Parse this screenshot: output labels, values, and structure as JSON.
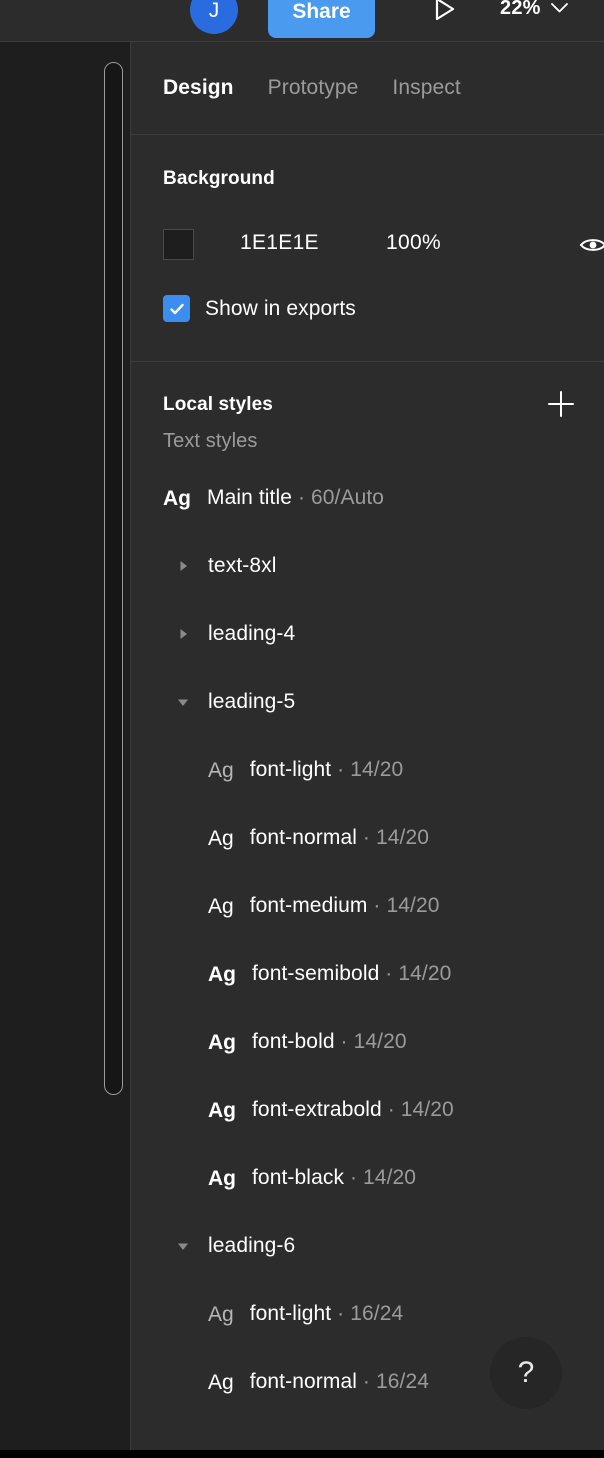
{
  "toolbar": {
    "avatar_initial": "J",
    "share_label": "Share",
    "present_icon": "play-triangle-icon",
    "zoom_level": "22%",
    "zoom_caret_icon": "chevron-down-icon"
  },
  "panel": {
    "tabs": [
      {
        "label": "Design",
        "active": true
      },
      {
        "label": "Prototype",
        "active": false
      },
      {
        "label": "Inspect",
        "active": false
      }
    ],
    "background": {
      "title": "Background",
      "color_hex": "1E1E1E",
      "swatch_color": "#1E1E1E",
      "opacity": "100%",
      "visibility_icon": "eye-icon",
      "show_in_exports": {
        "label": "Show in exports",
        "checked": true,
        "accent": "#3B8EF0"
      }
    },
    "local_styles": {
      "title": "Local styles",
      "add_icon": "plus-icon",
      "text_styles_label": "Text styles",
      "rows": [
        {
          "kind": "style",
          "level": 0,
          "preview": "Ag",
          "weight": "w700",
          "name": "Main title",
          "meta": " · 60/Auto"
        },
        {
          "kind": "group",
          "level": 0,
          "expanded": false,
          "name": "text-8xl"
        },
        {
          "kind": "group",
          "level": 0,
          "expanded": false,
          "name": "leading-4"
        },
        {
          "kind": "group",
          "level": 0,
          "expanded": true,
          "name": "leading-5"
        },
        {
          "kind": "style",
          "level": 1,
          "preview": "Ag",
          "weight": "w300",
          "name": "font-light",
          "meta": " · 14/20"
        },
        {
          "kind": "style",
          "level": 1,
          "preview": "Ag",
          "weight": "w400",
          "name": "font-normal",
          "meta": " · 14/20"
        },
        {
          "kind": "style",
          "level": 1,
          "preview": "Ag",
          "weight": "w500",
          "name": "font-medium",
          "meta": " · 14/20"
        },
        {
          "kind": "style",
          "level": 1,
          "preview": "Ag",
          "weight": "w600",
          "name": "font-semibold",
          "meta": " · 14/20"
        },
        {
          "kind": "style",
          "level": 1,
          "preview": "Ag",
          "weight": "w700",
          "name": "font-bold",
          "meta": " · 14/20"
        },
        {
          "kind": "style",
          "level": 1,
          "preview": "Ag",
          "weight": "w800",
          "name": "font-extrabold",
          "meta": " · 14/20"
        },
        {
          "kind": "style",
          "level": 1,
          "preview": "Ag",
          "weight": "w900",
          "name": "font-black",
          "meta": " · 14/20"
        },
        {
          "kind": "group",
          "level": 0,
          "expanded": true,
          "name": "leading-6"
        },
        {
          "kind": "style",
          "level": 1,
          "preview": "Ag",
          "weight": "w300",
          "name": "font-light",
          "meta": " · 16/24"
        },
        {
          "kind": "style",
          "level": 1,
          "preview": "Ag",
          "weight": "w400",
          "name": "font-normal",
          "meta": " · 16/24"
        }
      ]
    }
  },
  "canvas": {
    "shape_name": "rounded-rectangle"
  },
  "help": {
    "label": "?"
  }
}
